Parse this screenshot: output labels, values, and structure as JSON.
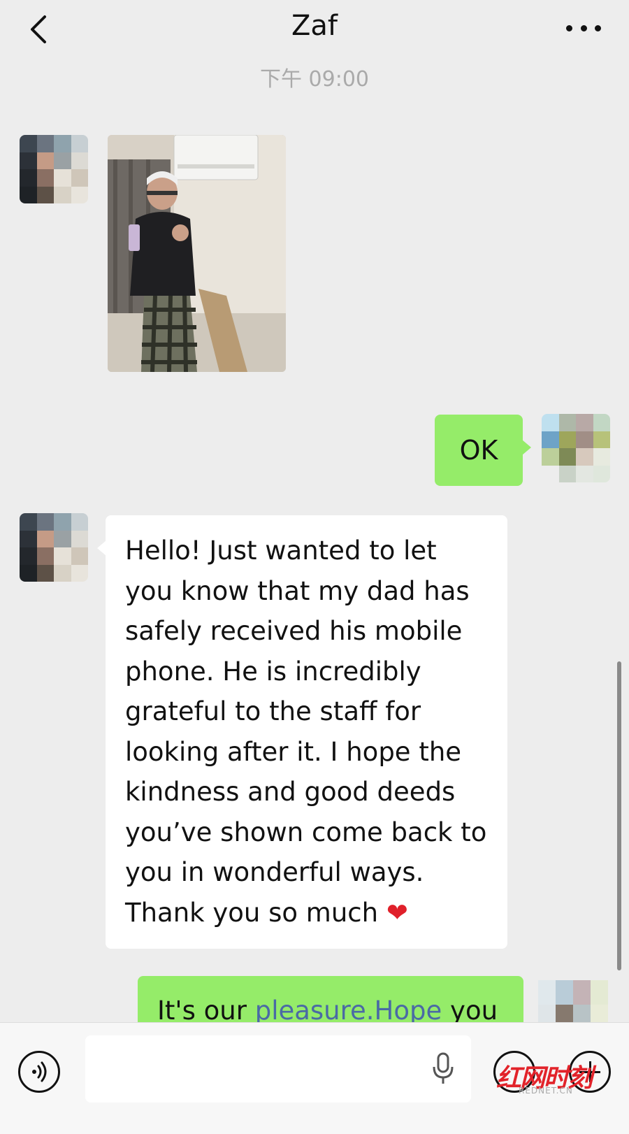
{
  "header": {
    "title": "Zaf",
    "back_icon": "chevron-left-icon",
    "more_icon": "more-dots-icon"
  },
  "timestamp": "下午 09:00",
  "messages": [
    {
      "type": "image",
      "side": "left",
      "description_icon": "photo-message"
    },
    {
      "type": "text",
      "side": "right",
      "text": "OK"
    },
    {
      "type": "text",
      "side": "left",
      "text": "Hello! Just wanted to let\nyou know that my dad has\nsafely received his mobile\nphone. He is incredibly\ngrateful to the staff for\nlooking after it. I hope the\nkindness and good deeds\nyou’ve shown come back to\nyou in wonderful ways.\nThank you so much",
      "emoji": "❤"
    },
    {
      "type": "text",
      "side": "right",
      "text_start": "It's our ",
      "text_link": "pleasure.Hope",
      "text_end": " you"
    }
  ],
  "bottom_bar": {
    "voice_icon": "voice-icon",
    "mic_icon": "microphone-icon",
    "emoji_icon": "emoji-icon",
    "plus_icon": "plus-icon"
  },
  "watermark": {
    "text": "红网时刻",
    "sub": "REDNET.CN"
  },
  "colors": {
    "background": "#ededed",
    "bubble_green": "#95ec69",
    "bubble_white": "#ffffff",
    "link": "#4a6aa5"
  }
}
